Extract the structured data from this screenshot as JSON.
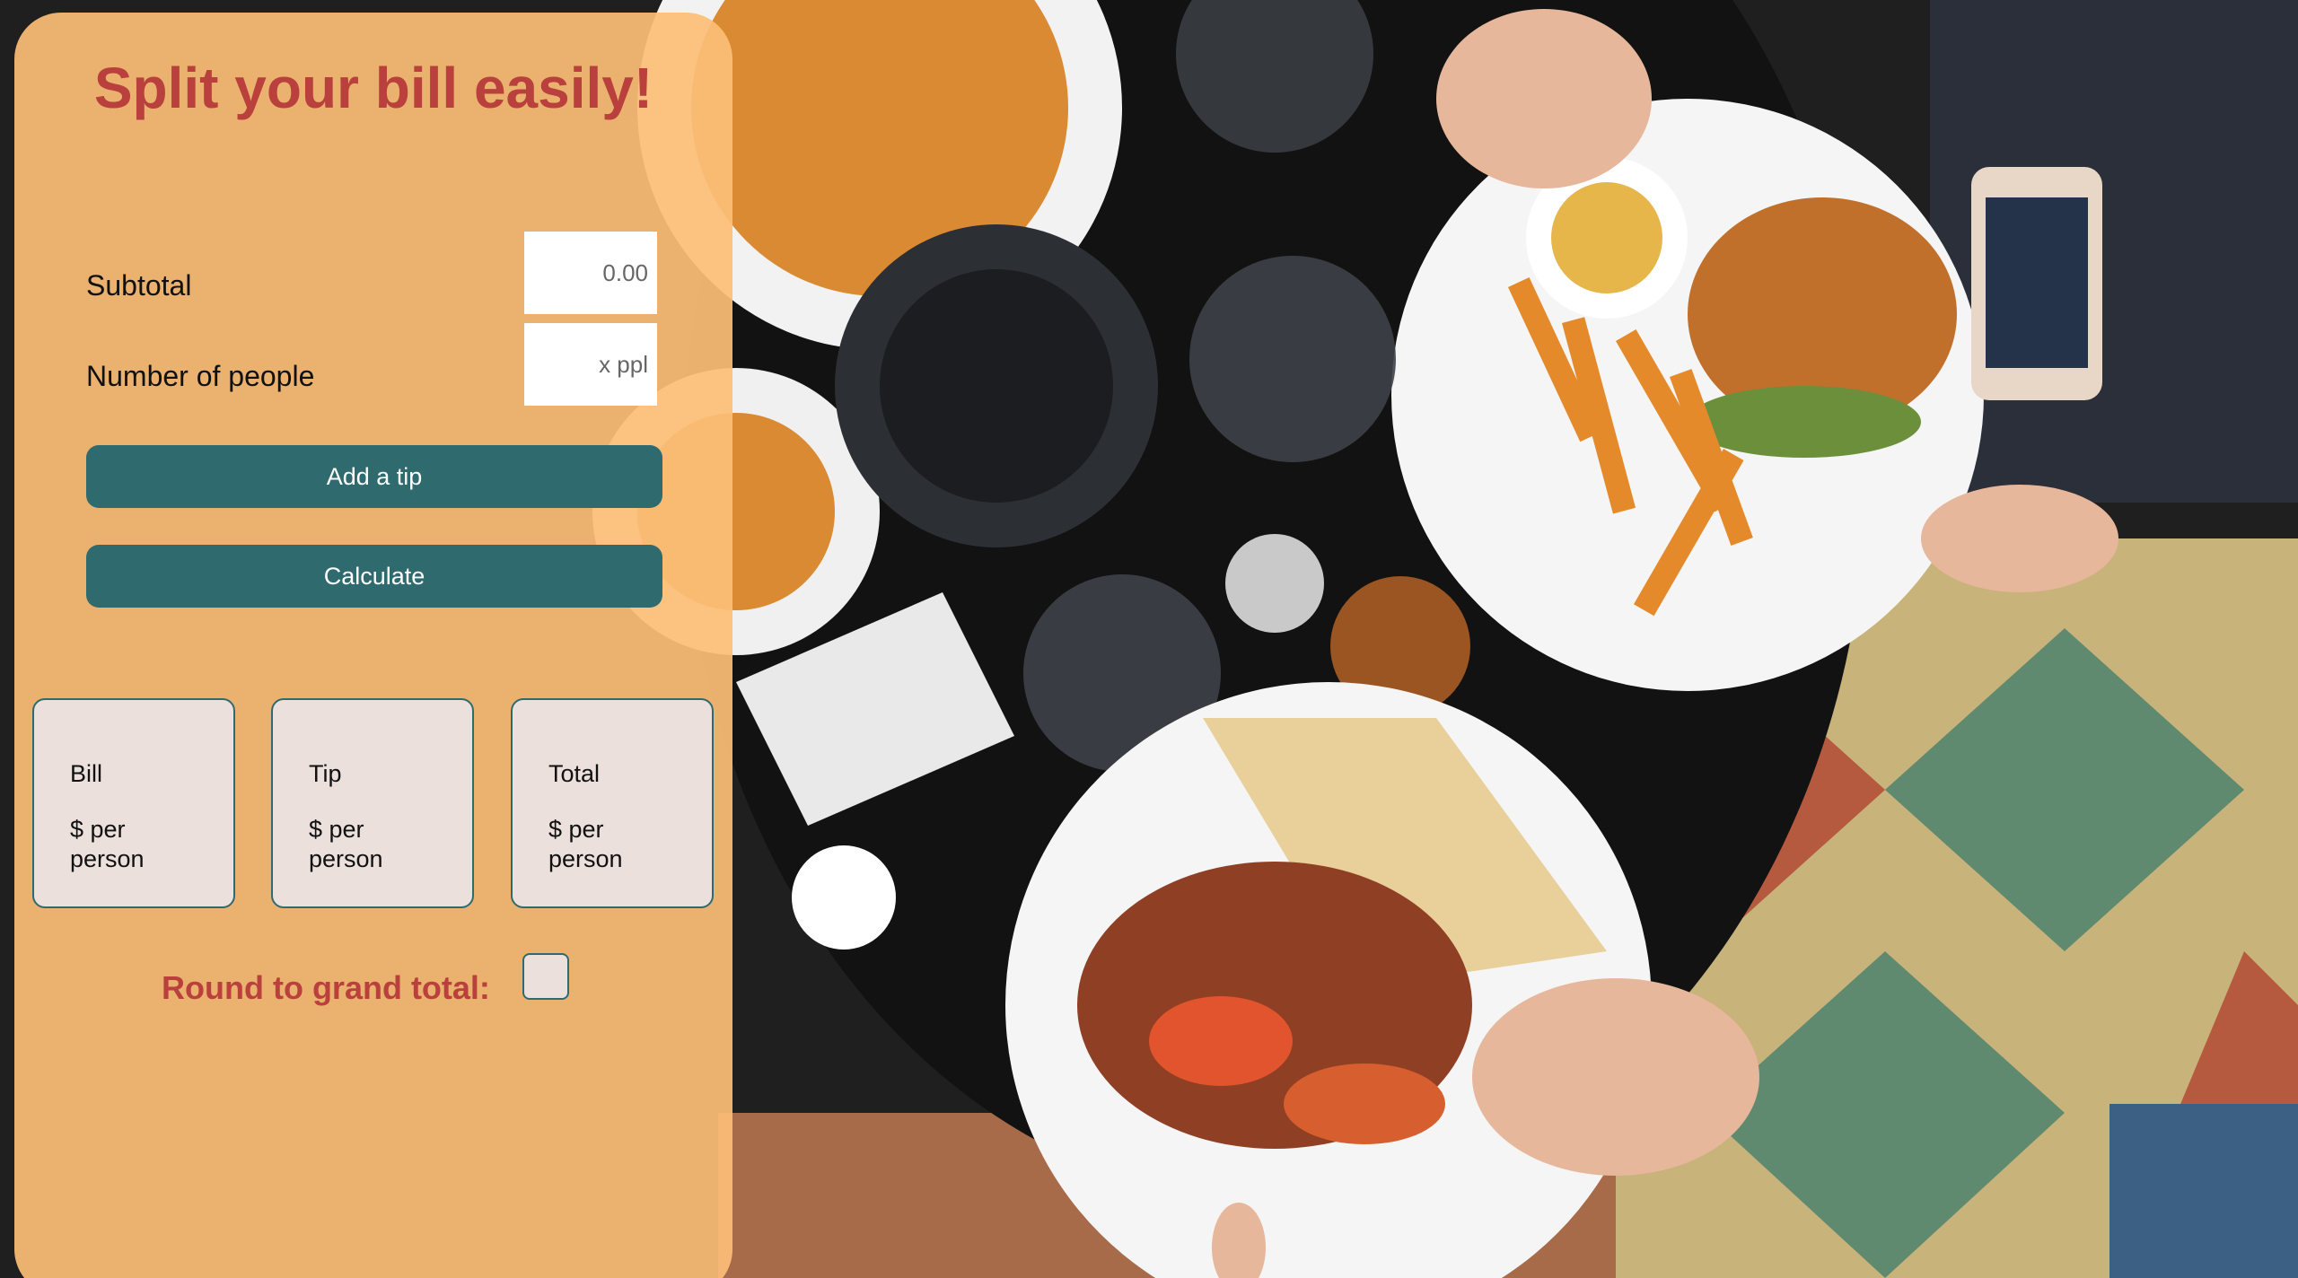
{
  "header": {
    "title": "Split your bill easily!"
  },
  "form": {
    "subtotal_label": "Subtotal",
    "subtotal_placeholder": "0.00",
    "subtotal_value": "",
    "people_label": "Number of people",
    "people_placeholder": "x ppl",
    "people_value": ""
  },
  "buttons": {
    "add_tip_label": "Add a tip",
    "calculate_label": "Calculate"
  },
  "results": [
    {
      "title": "Bill",
      "value": "$ per person"
    },
    {
      "title": "Tip",
      "value": "$ per person"
    },
    {
      "title": "Total",
      "value": "$ per person"
    }
  ],
  "rounding": {
    "label": "Round to grand total:",
    "checked": false
  },
  "colors": {
    "panel": "#fcbe76",
    "title": "#b9403d",
    "button": "#2f6a6f",
    "card": "#ece0dc"
  },
  "background": {
    "image_subject": "overhead-table-meal-photo"
  }
}
